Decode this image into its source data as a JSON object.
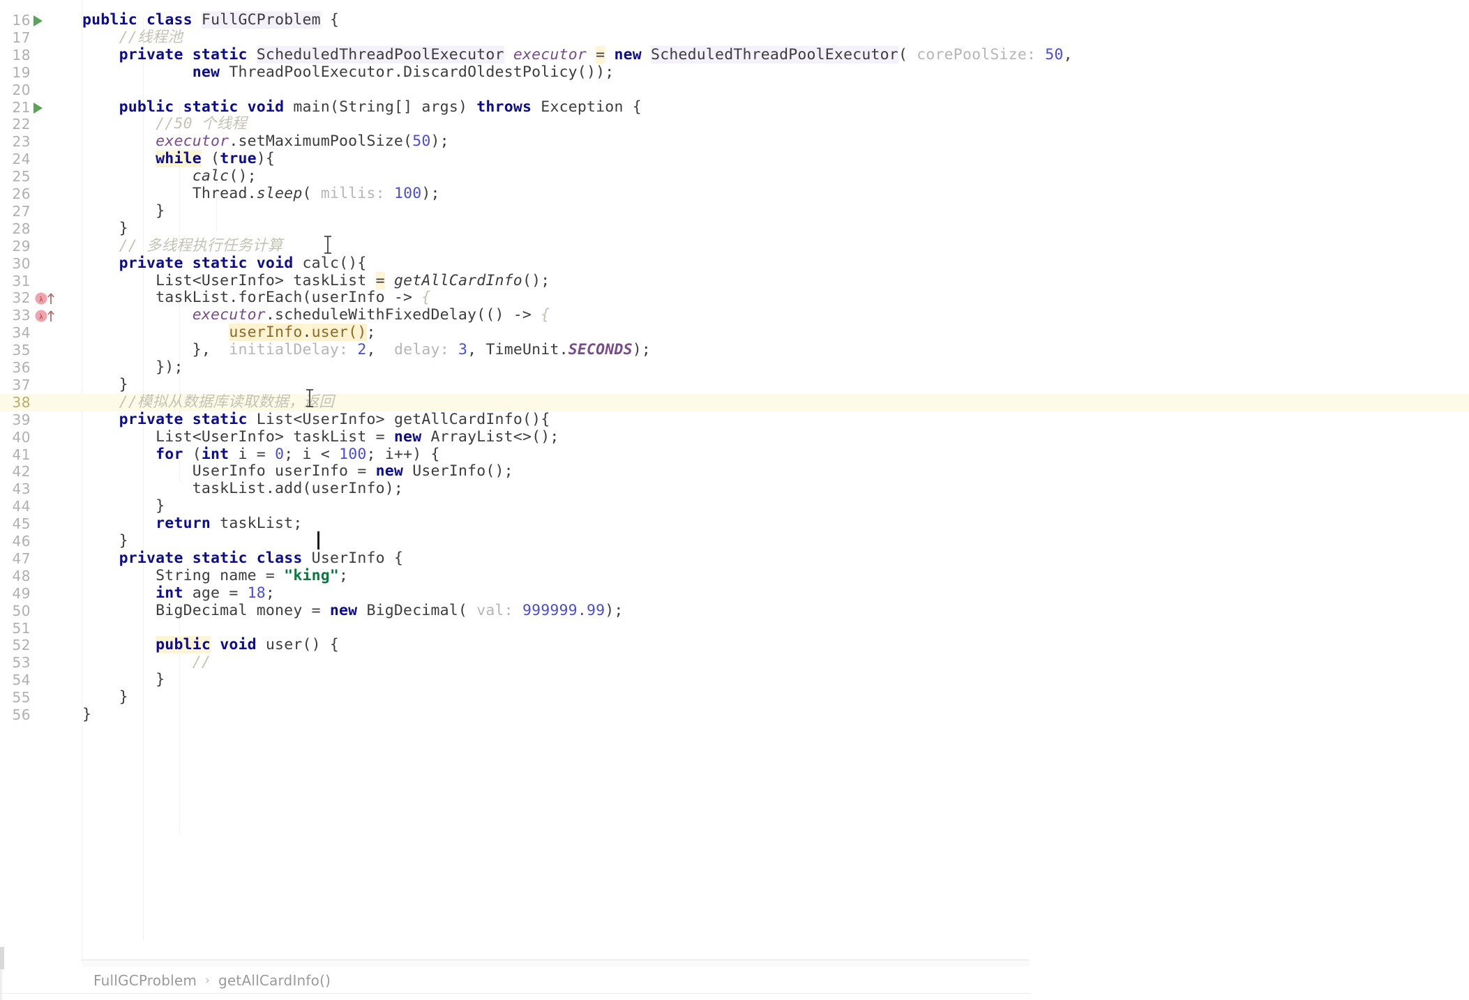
{
  "editor": {
    "language": "java",
    "file_class": "FullGCProblem",
    "current_line": 38,
    "colors": {
      "background": "#ffffff",
      "keyword": "#0b0c8f",
      "number": "#4a4ae0",
      "string": "#087a3f",
      "comment": "#c3c3b5",
      "field": "#7a4b8c",
      "param_hint": "#b6b6b6",
      "line_number": "#b0b0b0",
      "current_line_bg": "#fdfbe8",
      "run_marker": "#5da25c",
      "lambda_marker": "#e8909a"
    }
  },
  "breadcrumb": {
    "class": "FullGCProblem",
    "separator": "›",
    "method": "getAllCardInfo()"
  },
  "lines": [
    {
      "n": "16",
      "indent": 0,
      "marker": "run",
      "tokens": [
        {
          "t": "public",
          "c": "kw"
        },
        {
          "t": " ",
          "c": "plain"
        },
        {
          "t": "class",
          "c": "kw"
        },
        {
          "t": " ",
          "c": "plain"
        },
        {
          "t": "FullGCProblem",
          "c": "cls hl2"
        },
        {
          "t": " {",
          "c": "plain"
        }
      ]
    },
    {
      "n": "17",
      "indent": 0,
      "marker": "",
      "tokens": [
        {
          "t": "    //线程池",
          "c": "cmt"
        }
      ]
    },
    {
      "n": "18",
      "indent": 0,
      "marker": "",
      "tokens": [
        {
          "t": "    ",
          "c": "plain"
        },
        {
          "t": "private",
          "c": "kw"
        },
        {
          "t": " ",
          "c": "plain"
        },
        {
          "t": "static",
          "c": "kw"
        },
        {
          "t": " ",
          "c": "plain"
        },
        {
          "t": "ScheduledThreadPoolExecutor",
          "c": "cls hl2"
        },
        {
          "t": " ",
          "c": "plain"
        },
        {
          "t": "executor",
          "c": "fld"
        },
        {
          "t": " ",
          "c": "plain"
        },
        {
          "t": "=",
          "c": "plain hl"
        },
        {
          "t": " ",
          "c": "plain"
        },
        {
          "t": "new",
          "c": "kw"
        },
        {
          "t": " ",
          "c": "plain"
        },
        {
          "t": "ScheduledThreadPoolExecutor",
          "c": "cls hl2"
        },
        {
          "t": "( ",
          "c": "plain"
        },
        {
          "t": "corePoolSize:",
          "c": "hint"
        },
        {
          "t": " ",
          "c": "plain"
        },
        {
          "t": "50",
          "c": "num-lit"
        },
        {
          "t": ",",
          "c": "plain"
        }
      ]
    },
    {
      "n": "19",
      "indent": 0,
      "marker": "",
      "tokens": [
        {
          "t": "            ",
          "c": "plain"
        },
        {
          "t": "new",
          "c": "kw"
        },
        {
          "t": " ",
          "c": "plain"
        },
        {
          "t": "ThreadPoolExecutor.DiscardOldestPolicy());",
          "c": "plain"
        }
      ]
    },
    {
      "n": "20",
      "indent": 0,
      "marker": "",
      "tokens": []
    },
    {
      "n": "21",
      "indent": 0,
      "marker": "run",
      "tokens": [
        {
          "t": "    ",
          "c": "plain"
        },
        {
          "t": "public",
          "c": "kw"
        },
        {
          "t": " ",
          "c": "plain"
        },
        {
          "t": "static",
          "c": "kw"
        },
        {
          "t": " ",
          "c": "plain"
        },
        {
          "t": "void",
          "c": "kw"
        },
        {
          "t": " ",
          "c": "plain"
        },
        {
          "t": "main(String[] args) ",
          "c": "plain"
        },
        {
          "t": "throws",
          "c": "kw"
        },
        {
          "t": " ",
          "c": "plain"
        },
        {
          "t": "Exception {",
          "c": "plain"
        }
      ]
    },
    {
      "n": "22",
      "indent": 0,
      "marker": "",
      "tokens": [
        {
          "t": "        //50 个线程",
          "c": "cmt"
        }
      ]
    },
    {
      "n": "23",
      "indent": 0,
      "marker": "",
      "tokens": [
        {
          "t": "        ",
          "c": "plain"
        },
        {
          "t": "executor",
          "c": "fld"
        },
        {
          "t": ".setMaximumPoolSize(",
          "c": "plain"
        },
        {
          "t": "50",
          "c": "num-lit"
        },
        {
          "t": ");",
          "c": "plain"
        }
      ]
    },
    {
      "n": "24",
      "indent": 0,
      "marker": "",
      "tokens": [
        {
          "t": "        ",
          "c": "plain"
        },
        {
          "t": "while",
          "c": "kw hl"
        },
        {
          "t": " (",
          "c": "plain"
        },
        {
          "t": "true",
          "c": "kw"
        },
        {
          "t": "){",
          "c": "plain"
        }
      ]
    },
    {
      "n": "25",
      "indent": 0,
      "marker": "",
      "tokens": [
        {
          "t": "            ",
          "c": "plain"
        },
        {
          "t": "calc",
          "c": "mthi"
        },
        {
          "t": "();",
          "c": "plain"
        }
      ]
    },
    {
      "n": "26",
      "indent": 0,
      "marker": "",
      "tokens": [
        {
          "t": "            Thread.",
          "c": "plain"
        },
        {
          "t": "sleep",
          "c": "mthi"
        },
        {
          "t": "( ",
          "c": "plain"
        },
        {
          "t": "millis:",
          "c": "hint"
        },
        {
          "t": " ",
          "c": "plain"
        },
        {
          "t": "100",
          "c": "num-lit"
        },
        {
          "t": ");",
          "c": "plain"
        }
      ]
    },
    {
      "n": "27",
      "indent": 0,
      "marker": "",
      "tokens": [
        {
          "t": "        }",
          "c": "plain"
        }
      ]
    },
    {
      "n": "28",
      "indent": 0,
      "marker": "",
      "tokens": [
        {
          "t": "    }",
          "c": "plain"
        }
      ]
    },
    {
      "n": "29",
      "indent": 0,
      "marker": "",
      "tokens": [
        {
          "t": "    // 多线程执行任务计算",
          "c": "cmt"
        }
      ]
    },
    {
      "n": "30",
      "indent": 0,
      "marker": "",
      "tokens": [
        {
          "t": "    ",
          "c": "plain"
        },
        {
          "t": "private",
          "c": "kw"
        },
        {
          "t": " ",
          "c": "plain"
        },
        {
          "t": "static",
          "c": "kw"
        },
        {
          "t": " ",
          "c": "plain"
        },
        {
          "t": "void",
          "c": "kw"
        },
        {
          "t": " ",
          "c": "plain"
        },
        {
          "t": "calc(){",
          "c": "plain"
        }
      ]
    },
    {
      "n": "31",
      "indent": 0,
      "marker": "",
      "tokens": [
        {
          "t": "        List<UserInfo> taskList ",
          "c": "plain"
        },
        {
          "t": "=",
          "c": "plain hl"
        },
        {
          "t": " ",
          "c": "plain"
        },
        {
          "t": "getAllCardInfo",
          "c": "mthi"
        },
        {
          "t": "();",
          "c": "plain"
        }
      ]
    },
    {
      "n": "32",
      "indent": 0,
      "marker": "lambda",
      "tokens": [
        {
          "t": "        taskList.forEach(userInfo ",
          "c": "plain"
        },
        {
          "t": "->",
          "c": "plain"
        },
        {
          "t": " {",
          "c": "cmt"
        }
      ]
    },
    {
      "n": "33",
      "indent": 0,
      "marker": "lambda",
      "tokens": [
        {
          "t": "            ",
          "c": "plain"
        },
        {
          "t": "executor",
          "c": "fld"
        },
        {
          "t": ".scheduleWithFixedDelay(() ",
          "c": "plain"
        },
        {
          "t": "->",
          "c": "plain"
        },
        {
          "t": " {",
          "c": "cmt"
        }
      ]
    },
    {
      "n": "34",
      "indent": 0,
      "marker": "",
      "tokens": [
        {
          "t": "                ",
          "c": "plain"
        },
        {
          "t": "userInfo",
          "c": "hl3"
        },
        {
          "t": ".",
          "c": "hl"
        },
        {
          "t": "user()",
          "c": "hl3"
        },
        {
          "t": ";",
          "c": "plain"
        }
      ]
    },
    {
      "n": "35",
      "indent": 0,
      "marker": "",
      "tokens": [
        {
          "t": "            },",
          "c": "plain"
        },
        {
          "t": "  ",
          "c": "plain"
        },
        {
          "t": "initialDelay:",
          "c": "hint"
        },
        {
          "t": " ",
          "c": "plain"
        },
        {
          "t": "2",
          "c": "num-lit"
        },
        {
          "t": ",",
          "c": "plain"
        },
        {
          "t": "  ",
          "c": "plain"
        },
        {
          "t": "delay:",
          "c": "hint"
        },
        {
          "t": " ",
          "c": "plain"
        },
        {
          "t": "3",
          "c": "num-lit"
        },
        {
          "t": ", TimeUnit.",
          "c": "plain"
        },
        {
          "t": "SECONDS",
          "c": "const"
        },
        {
          "t": ");",
          "c": "plain"
        }
      ]
    },
    {
      "n": "36",
      "indent": 0,
      "marker": "",
      "tokens": [
        {
          "t": "        });",
          "c": "plain"
        }
      ]
    },
    {
      "n": "37",
      "indent": 0,
      "marker": "",
      "tokens": [
        {
          "t": "    }",
          "c": "plain"
        }
      ]
    },
    {
      "n": "38",
      "indent": 0,
      "marker": "",
      "current": true,
      "tokens": [
        {
          "t": "    //模拟从数据库读取数据，返回",
          "c": "cmt"
        }
      ]
    },
    {
      "n": "39",
      "indent": 0,
      "marker": "",
      "tokens": [
        {
          "t": "    ",
          "c": "plain"
        },
        {
          "t": "private",
          "c": "kw"
        },
        {
          "t": " ",
          "c": "plain"
        },
        {
          "t": "static",
          "c": "kw"
        },
        {
          "t": " ",
          "c": "plain"
        },
        {
          "t": "List<UserInfo> getAllCardInfo(){",
          "c": "plain"
        }
      ]
    },
    {
      "n": "40",
      "indent": 0,
      "marker": "",
      "tokens": [
        {
          "t": "        List<UserInfo> taskList = ",
          "c": "plain"
        },
        {
          "t": "new",
          "c": "kw"
        },
        {
          "t": " ",
          "c": "plain"
        },
        {
          "t": "ArrayList<>();",
          "c": "plain"
        }
      ]
    },
    {
      "n": "41",
      "indent": 0,
      "marker": "",
      "tokens": [
        {
          "t": "        ",
          "c": "plain"
        },
        {
          "t": "for",
          "c": "kw"
        },
        {
          "t": " (",
          "c": "plain"
        },
        {
          "t": "int",
          "c": "kw"
        },
        {
          "t": " i = ",
          "c": "plain"
        },
        {
          "t": "0",
          "c": "num-lit"
        },
        {
          "t": "; i < ",
          "c": "plain"
        },
        {
          "t": "100",
          "c": "num-lit"
        },
        {
          "t": "; i++) {",
          "c": "plain"
        }
      ]
    },
    {
      "n": "42",
      "indent": 0,
      "marker": "",
      "tokens": [
        {
          "t": "            UserInfo userInfo = ",
          "c": "plain"
        },
        {
          "t": "new",
          "c": "kw"
        },
        {
          "t": " ",
          "c": "plain"
        },
        {
          "t": "UserInfo();",
          "c": "plain"
        }
      ]
    },
    {
      "n": "43",
      "indent": 0,
      "marker": "",
      "tokens": [
        {
          "t": "            taskList.add(userInfo);",
          "c": "plain"
        }
      ]
    },
    {
      "n": "44",
      "indent": 0,
      "marker": "",
      "tokens": [
        {
          "t": "        }",
          "c": "plain"
        }
      ]
    },
    {
      "n": "45",
      "indent": 0,
      "marker": "",
      "tokens": [
        {
          "t": "        ",
          "c": "plain"
        },
        {
          "t": "return",
          "c": "kw"
        },
        {
          "t": " taskList;",
          "c": "plain"
        }
      ]
    },
    {
      "n": "46",
      "indent": 0,
      "marker": "",
      "tokens": [
        {
          "t": "    }",
          "c": "plain"
        }
      ]
    },
    {
      "n": "47",
      "indent": 0,
      "marker": "",
      "tokens": [
        {
          "t": "    ",
          "c": "plain"
        },
        {
          "t": "private",
          "c": "kw"
        },
        {
          "t": " ",
          "c": "plain"
        },
        {
          "t": "static",
          "c": "kw"
        },
        {
          "t": " ",
          "c": "plain"
        },
        {
          "t": "class",
          "c": "kw"
        },
        {
          "t": " ",
          "c": "plain"
        },
        {
          "t": "UserInfo {",
          "c": "plain"
        }
      ]
    },
    {
      "n": "48",
      "indent": 0,
      "marker": "",
      "tokens": [
        {
          "t": "        String name = ",
          "c": "plain"
        },
        {
          "t": "\"king\"",
          "c": "str"
        },
        {
          "t": ";",
          "c": "plain"
        }
      ]
    },
    {
      "n": "49",
      "indent": 0,
      "marker": "",
      "tokens": [
        {
          "t": "        ",
          "c": "plain"
        },
        {
          "t": "int",
          "c": "kw"
        },
        {
          "t": " age = ",
          "c": "plain"
        },
        {
          "t": "18",
          "c": "num-lit"
        },
        {
          "t": ";",
          "c": "plain"
        }
      ]
    },
    {
      "n": "50",
      "indent": 0,
      "marker": "",
      "tokens": [
        {
          "t": "        BigDecimal money = ",
          "c": "plain"
        },
        {
          "t": "new",
          "c": "kw"
        },
        {
          "t": " ",
          "c": "plain"
        },
        {
          "t": "BigDecimal( ",
          "c": "plain"
        },
        {
          "t": "val:",
          "c": "hint"
        },
        {
          "t": " ",
          "c": "plain"
        },
        {
          "t": "999999.99",
          "c": "num-lit"
        },
        {
          "t": ");",
          "c": "plain"
        }
      ]
    },
    {
      "n": "51",
      "indent": 0,
      "marker": "",
      "tokens": []
    },
    {
      "n": "52",
      "indent": 0,
      "marker": "",
      "tokens": [
        {
          "t": "        ",
          "c": "plain"
        },
        {
          "t": "public",
          "c": "kw hl"
        },
        {
          "t": " ",
          "c": "plain"
        },
        {
          "t": "void",
          "c": "kw"
        },
        {
          "t": " user() {",
          "c": "plain"
        }
      ]
    },
    {
      "n": "53",
      "indent": 0,
      "marker": "",
      "tokens": [
        {
          "t": "            //",
          "c": "cmt"
        }
      ]
    },
    {
      "n": "54",
      "indent": 0,
      "marker": "",
      "tokens": [
        {
          "t": "        }",
          "c": "plain"
        }
      ]
    },
    {
      "n": "55",
      "indent": 0,
      "marker": "",
      "tokens": [
        {
          "t": "    }",
          "c": "plain"
        }
      ]
    },
    {
      "n": "56",
      "indent": 0,
      "marker": "",
      "tokens": [
        {
          "t": "}",
          "c": "plain"
        }
      ]
    }
  ]
}
